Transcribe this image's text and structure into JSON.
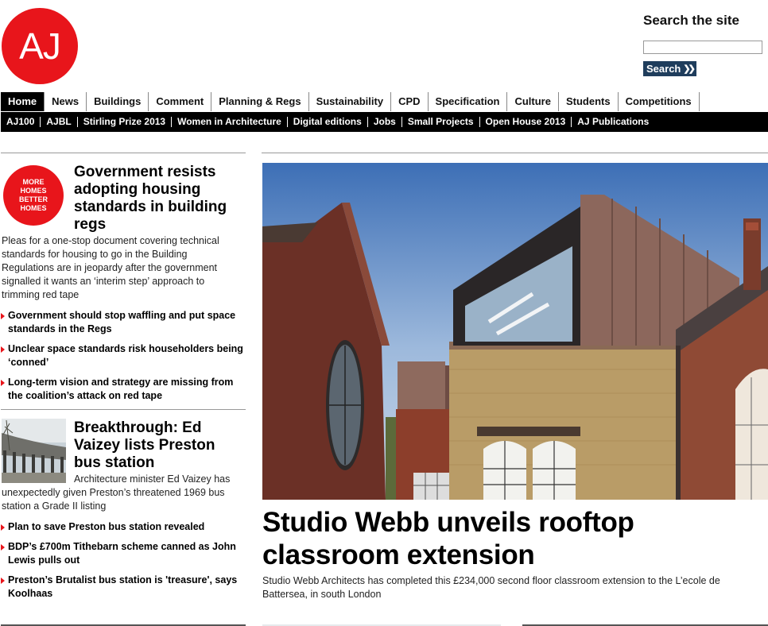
{
  "logo": {
    "text": "AJ"
  },
  "search": {
    "title": "Search the site",
    "placeholder": "",
    "button_label": "Search",
    "button_icon": "double-chevron-right"
  },
  "nav_main": [
    "Home",
    "News",
    "Buildings",
    "Comment",
    "Planning & Regs",
    "Sustainability",
    "CPD",
    "Specification",
    "Culture",
    "Students",
    "Competitions"
  ],
  "nav_main_active": "Home",
  "nav_sub": [
    "AJ100",
    "AJBL",
    "Stirling Prize 2013",
    "Women in Architecture",
    "Digital editions",
    "Jobs",
    "Small Projects",
    "Open House 2013",
    "AJ Publications"
  ],
  "story1": {
    "badge_text": "MORE HOMES BETTER HOMES",
    "title": "Government resists adopting housing standards in building regs",
    "summary": "Pleas for a one-stop document covering technical standards for housing to go in the Building Regulations are in jeopardy after the government signalled it wants an ‘interim step’ approach to trimming red tape",
    "links": [
      "Government should stop waffling and put space standards in the Regs",
      "Unclear space standards risk householders being ‘conned’",
      "Long-term vision and strategy are missing from the coalition’s attack on red tape"
    ]
  },
  "story2": {
    "title": "Breakthrough: Ed Vaizey lists Preston bus station",
    "summary": "Architecture minister Ed Vaizey has unexpectedly given Preston’s threatened 1969 bus station a Grade II listing",
    "links": [
      "Plan to save Preston bus station revealed",
      "BDP’s £700m Tithebarn scheme canned as John Lewis pulls out",
      "Preston’s Brutalist bus station is 'treasure', says Koolhaas"
    ]
  },
  "hero": {
    "title": "Studio Webb unveils rooftop classroom extension",
    "description": "Studio Webb Architects has completed this £234,000 second floor classroom extension to the L’ecole de Battersea, in south London"
  },
  "colors": {
    "brand_red": "#e8151b",
    "nav_black": "#000000",
    "search_button": "#1f3d5c"
  }
}
